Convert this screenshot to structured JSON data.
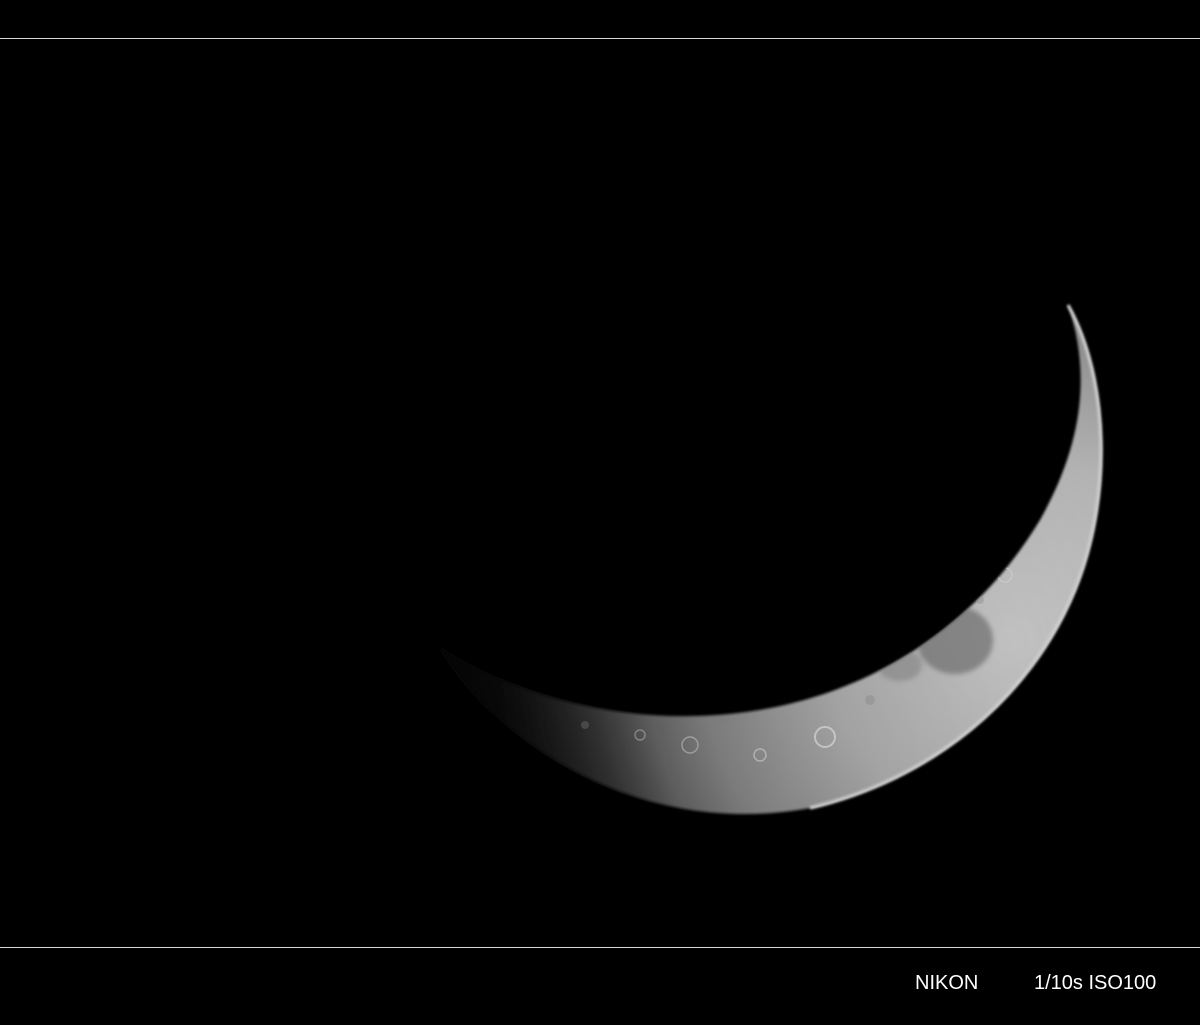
{
  "photo": {
    "subject": "crescent-moon",
    "background_color": "#000000",
    "moon_highlight_color": "#f2f2f2",
    "moon_shadow_color": "#3a3a3a",
    "frame_line_color": "#d8d8d8"
  },
  "caption": {
    "brand": "NIKON",
    "exposure": "1/10s ISO100"
  }
}
